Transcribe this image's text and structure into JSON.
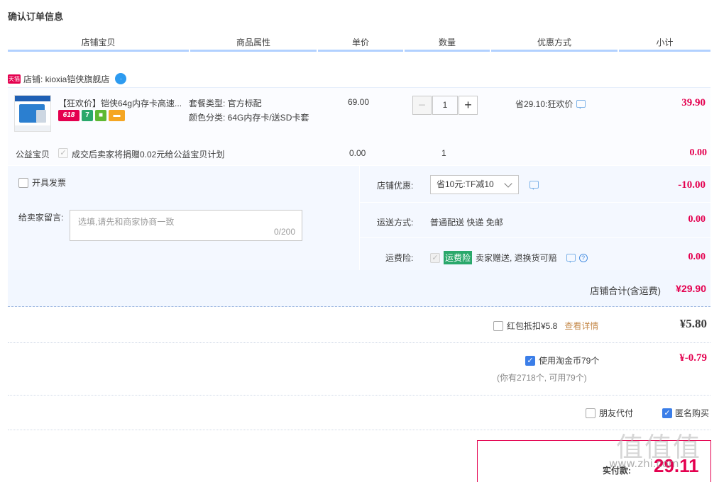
{
  "page_title": "确认订单信息",
  "columns": [
    "店铺宝贝",
    "商品属性",
    "单价",
    "数量",
    "优惠方式",
    "小计"
  ],
  "shop": {
    "badge": "天猫",
    "label": "店铺: kioxia铠侠旗舰店"
  },
  "item": {
    "title": "【狂欢价】铠侠64g内存卡高速...",
    "tags": [
      "618",
      "7"
    ],
    "sku_package": "套餐类型: 官方标配",
    "sku_color": "颜色分类: 64G内存卡/送SD卡套",
    "unit_price": "69.00",
    "quantity": "1",
    "qty_minus": "−",
    "qty_plus": "+",
    "discount": "省29.10:狂欢价",
    "subtotal": "39.90"
  },
  "charity": {
    "label": "公益宝贝",
    "text": "成交后卖家将捐赠0.02元给公益宝贝计划",
    "price": "0.00",
    "qty": "1",
    "subtotal": "0.00"
  },
  "invoice": {
    "label": "开具发票"
  },
  "message": {
    "label": "给卖家留言:",
    "placeholder": "选填,请先和商家协商一致",
    "count": "0/200"
  },
  "shop_discount": {
    "label": "店铺优惠:",
    "selected": "省10元:TF减10",
    "amount": "-10.00"
  },
  "shipping": {
    "label": "运送方式:",
    "value": "普通配送 快递 免邮",
    "amount": "0.00"
  },
  "freight_insurance": {
    "label": "运费险:",
    "badge": "运费险",
    "text": "卖家赠送, 退换货可赔",
    "amount": "0.00"
  },
  "shop_total": {
    "label": "店铺合计(含运费)",
    "amount": "¥29.90"
  },
  "red_packet": {
    "label": "红包抵扣¥5.8",
    "link": "查看详情",
    "amount": "¥5.80"
  },
  "taojinbi": {
    "label": "使用淘金币79个",
    "note": "(你有2718个, 可用79个)",
    "amount": "¥-0.79"
  },
  "options": {
    "friend_pay": "朋友代付",
    "anonymous": "匿名购买"
  },
  "pay": {
    "label": "实付款:",
    "amount": "29.11"
  },
  "watermark": {
    "big": "值值值",
    "site": "www.zhi.com"
  },
  "colors": {
    "accent_red": "#e4004f",
    "header_line": "#b2d1ff",
    "panel_bg": "#f4f8ff",
    "check_blue": "#3b7ee8",
    "freight_green": "#2aa86b"
  }
}
